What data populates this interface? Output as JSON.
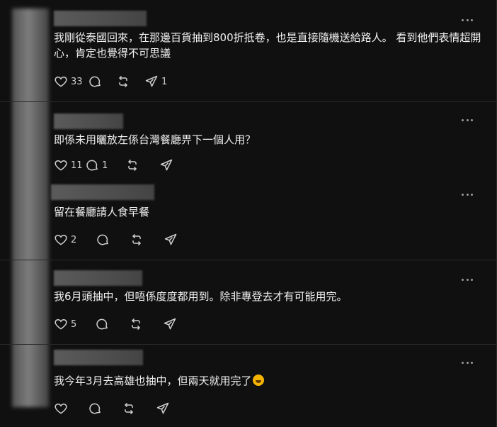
{
  "icons": {
    "like": "heart-icon",
    "reply": "comment-bubble-icon",
    "repost": "repost-arrows-icon",
    "share": "paper-plane-share-icon",
    "more": "more-dots-icon"
  },
  "comments": [
    {
      "text": "我剛從泰國回來，在那邊百貨抽到800折抵卷，也是直接隨機送給路人。 看到他們表情超開心，肯定也覺得不可思議",
      "likes": "33",
      "replies": "",
      "reposts": "",
      "shares": "1"
    },
    {
      "text": "即係未用曬放左係台灣餐廳畀下一個人用？",
      "likes": "11",
      "replies": "1",
      "reposts": "",
      "shares": ""
    },
    {
      "text": "留在餐廳請人食早餐",
      "likes": "2",
      "replies": "",
      "reposts": "",
      "shares": ""
    },
    {
      "text": "我6月頭抽中，但唔係度度都用到。除非專登去才有可能用完。",
      "likes": "5",
      "replies": "",
      "reposts": "",
      "shares": ""
    },
    {
      "text": "我今年3月去高雄也抽中，但兩天就用完了",
      "emoji": "rolling-on-floor-laughing-emoji",
      "likes": "",
      "replies": "",
      "reposts": "",
      "shares": ""
    }
  ]
}
